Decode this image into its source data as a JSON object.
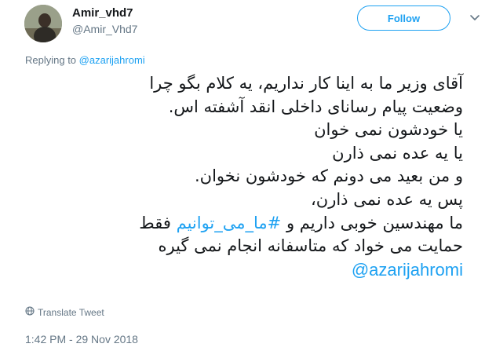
{
  "author": {
    "display_name": "Amir_vhd7",
    "screen_name": "@Amir_Vhd7"
  },
  "actions": {
    "follow_label": "Follow"
  },
  "replying": {
    "prefix": "Replying to",
    "mention": "@azarijahromi"
  },
  "tweet": {
    "lines": [
      "آقای وزیر ما به اینا کار نداریم، یه کلام بگو چرا",
      "وضعیت پیام رسانای داخلی انقد آشفته اس.",
      "یا خودشون نمی خوان",
      "یا یه عده نمی ذارن",
      "و من بعید می دونم که خودشون نخوان.",
      "پس یه عده نمی ذارن،",
      "ما مهندسین خوبی داریم و",
      "حمایت می خواد که متاسفانه انجام نمی گیره"
    ],
    "hashtag": "#ما_می_توانیم",
    "line7_suffix": "فقط",
    "mention": "@azarijahromi"
  },
  "footer": {
    "translate_label": "Translate Tweet",
    "timestamp": "1:42 PM - 29 Nov 2018"
  },
  "colors": {
    "accent": "#1da1f2",
    "secondary_text": "#657786",
    "primary_text": "#14171a"
  },
  "icons": {
    "caret": "chevron-down-icon",
    "translate": "globe-icon"
  }
}
